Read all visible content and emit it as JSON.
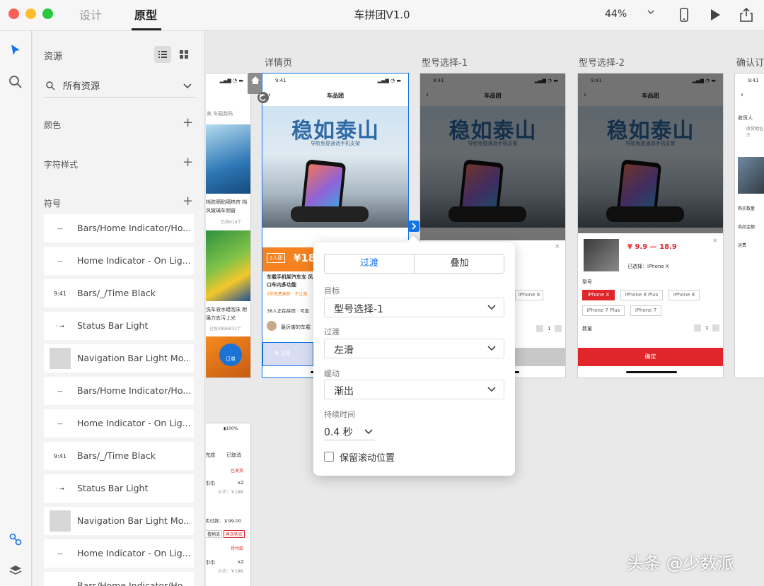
{
  "app": {
    "mode_tabs": [
      "设计",
      "原型"
    ],
    "active_mode": "原型",
    "document_title": "车拼团V1.0",
    "zoom": "44%"
  },
  "assets_panel": {
    "title": "资源",
    "search_value": "所有资源",
    "sections": {
      "colors": "颜色",
      "char_styles": "字符样式",
      "symbols": "符号"
    },
    "symbols": [
      {
        "thumb": "—",
        "label": "Bars/Home Indicator/Ho..."
      },
      {
        "thumb": "—",
        "label": "Home Indicator - On Lig..."
      },
      {
        "thumb": "9:41",
        "label": "Bars/_/Time Black"
      },
      {
        "thumb": "·  →",
        "label": "Status Bar Light"
      },
      {
        "thumb": "▭",
        "label": "Navigation Bar Light Mo..."
      },
      {
        "thumb": "—",
        "label": "Bars/Home Indicator/Ho..."
      },
      {
        "thumb": "—",
        "label": "Home Indicator - On Lig..."
      },
      {
        "thumb": "9:41",
        "label": "Bars/_/Time Black"
      },
      {
        "thumb": "·  →",
        "label": "Status Bar Light"
      },
      {
        "thumb": "▭",
        "label": "Navigation Bar Light Mo..."
      },
      {
        "thumb": "—",
        "label": "Home Indicator - On Lig..."
      },
      {
        "thumb": "",
        "label": "Bars/Home Indicator/Ho..."
      }
    ]
  },
  "canvas": {
    "artboard_labels": [
      "详情页",
      "型号选择-1",
      "型号选择-2",
      "确认订"
    ],
    "status_time": "9:41",
    "status_signal": "▂▄▆ ◔ ▬",
    "nav_title": "车品团",
    "back_glyph": "‹",
    "hero_title": "稳如泰山",
    "hero_subtitle": "导航免提通话手机支架",
    "left_partial": {
      "tabs": "美 车载数码",
      "item1": "挡防晒贴隔热帘 挡风玻璃车侧窗",
      "item1_sold": "已抢619个",
      "item2": "洗车液水蜡泡沫 附强力去污上光",
      "item2_sold": "已抢3896831个",
      "order_button": "订单",
      "bottom_status": "▮100%",
      "bottom_tabs": [
        "完成",
        "已取消"
      ],
      "bottom_badge1": "已发货",
      "bottom_item": "巾巾",
      "bottom_qty": "x2",
      "bottom_subtotal": "小计：￥198",
      "bottom_paid": "实付款：￥99.00",
      "bottom_btn1": "看物流",
      "bottom_btn2": "再次购买",
      "bottom_badge2": "待付款",
      "bottom_item2": "巾巾",
      "bottom_qty2": "x2",
      "bottom_subtotal2": "小计：￥198"
    },
    "detail": {
      "group_badge": "2人团",
      "price": "¥18",
      "product_title": "车载手机架汽车支 风口车内多功能",
      "product_note": "5年免费换新 · 不让商",
      "group_note": "38人正在拼团 · 可直",
      "review": "最厉害的车载",
      "bottom_price": "¥ 28"
    },
    "model_select": {
      "price_range": "¥ 9.9 — 18.9",
      "selected": "已选择：iPhone X",
      "model_label": "型号",
      "models": [
        "iPhone X",
        "iPhone 8 Plus",
        "iPhone 8",
        "iPhone 7 Plus",
        "iPhone 7"
      ],
      "qty_label": "数量",
      "qty_value": "1",
      "confirm": "确定",
      "close": "×"
    },
    "confirm_order": {
      "receiver": "收货人",
      "address": "收货地址 福州三",
      "labels": [
        "购买数量",
        "商品金额",
        "运费"
      ]
    }
  },
  "popover": {
    "segments": [
      "过渡",
      "叠加"
    ],
    "active_segment": "过渡",
    "target_label": "目标",
    "target_value": "型号选择-1",
    "transition_label": "过渡",
    "transition_value": "左滑",
    "easing_label": "缓动",
    "easing_value": "渐出",
    "duration_label": "持续时间",
    "duration_value": "0.4 秒",
    "preserve_scroll_label": "保留滚动位置",
    "preserve_scroll_checked": false
  },
  "watermark": "头条 @少数派",
  "colors": {
    "accent_blue": "#1473e6",
    "brand_red": "#e0262b",
    "orange": "#f5821f"
  }
}
